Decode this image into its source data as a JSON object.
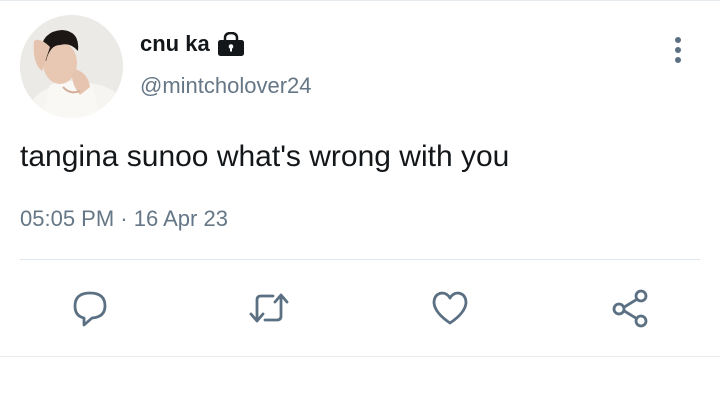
{
  "author": {
    "display_name": "cnu ka",
    "handle": "@mintcholover24",
    "protected_icon": "lock-icon",
    "avatar": "profile-photo"
  },
  "tweet": {
    "text": "tangina sunoo what's wrong with you",
    "time": "05:05 PM",
    "separator": "·",
    "date": "16 Apr 23"
  },
  "actions": [
    {
      "name": "reply",
      "icon": "speech-bubble-icon"
    },
    {
      "name": "retweet",
      "icon": "retweet-arrows-icon"
    },
    {
      "name": "like",
      "icon": "heart-icon"
    },
    {
      "name": "share",
      "icon": "share-icon"
    }
  ],
  "colors": {
    "primary_text": "#14171a",
    "secondary_text": "#657786",
    "icon": "#5b7083",
    "divider": "#e1e8ed"
  }
}
